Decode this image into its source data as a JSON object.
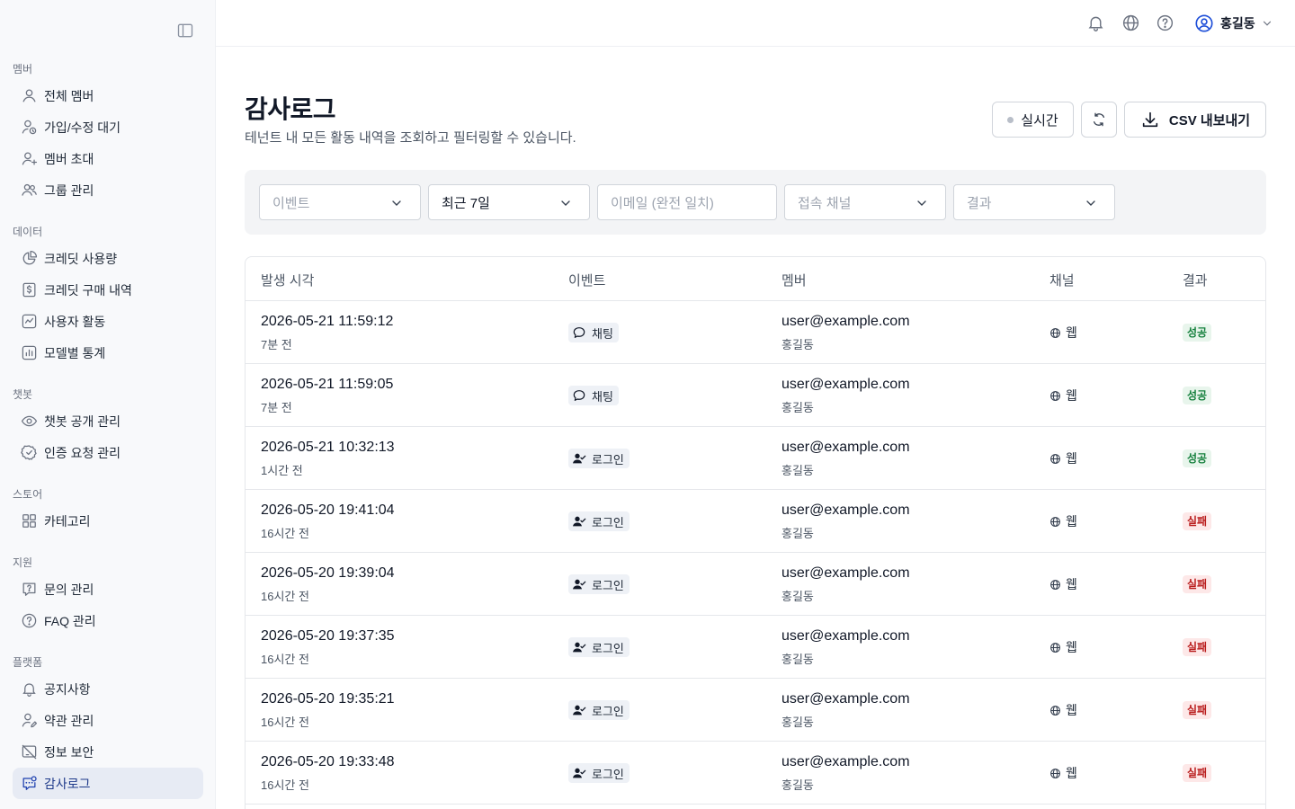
{
  "sidebar": {
    "groups": [
      {
        "title": "멤버",
        "items": [
          {
            "label": "전체 멤버",
            "icon": "user-icon"
          },
          {
            "label": "가입/수정 대기",
            "icon": "user-clock-icon"
          },
          {
            "label": "멤버 초대",
            "icon": "user-plus-icon"
          },
          {
            "label": "그룹 관리",
            "icon": "users-icon"
          }
        ]
      },
      {
        "title": "데이터",
        "items": [
          {
            "label": "크레딧 사용량",
            "icon": "pie-chart-icon"
          },
          {
            "label": "크레딧 구매 내역",
            "icon": "receipt-dollar-icon"
          },
          {
            "label": "사용자 활동",
            "icon": "activity-chart-icon"
          },
          {
            "label": "모델별 통계",
            "icon": "bar-chart-icon"
          }
        ]
      },
      {
        "title": "챗봇",
        "items": [
          {
            "label": "챗봇 공개 관리",
            "icon": "eye-icon"
          },
          {
            "label": "인증 요청 관리",
            "icon": "badge-check-icon"
          }
        ]
      },
      {
        "title": "스토어",
        "items": [
          {
            "label": "카테고리",
            "icon": "grid-icon"
          }
        ]
      },
      {
        "title": "지원",
        "items": [
          {
            "label": "문의 관리",
            "icon": "message-question-icon"
          },
          {
            "label": "FAQ 관리",
            "icon": "help-circle-icon"
          }
        ]
      },
      {
        "title": "플랫폼",
        "items": [
          {
            "label": "공지사항",
            "icon": "bell-icon"
          },
          {
            "label": "약관 관리",
            "icon": "user-pen-icon"
          },
          {
            "label": "정보 보안",
            "icon": "shield-off-icon"
          },
          {
            "label": "감사로그",
            "icon": "message-alert-icon",
            "active": true
          }
        ]
      }
    ]
  },
  "topbar": {
    "user_name": "홍길동",
    "icons": [
      "bell-icon",
      "globe-icon",
      "help-circle-icon"
    ]
  },
  "header": {
    "title": "감사로그",
    "subtitle": "테넌트 내 모든 활동 내역을 조회하고 필터링할 수 있습니다.",
    "live_label": "실시간",
    "csv_label": "CSV 내보내기"
  },
  "filters": {
    "event_placeholder": "이벤트",
    "range_value": "최근 7일",
    "email_placeholder": "이메일 (완전 일치)",
    "channel_placeholder": "접속 채널",
    "result_placeholder": "결과"
  },
  "table": {
    "columns": [
      "발생 시각",
      "이벤트",
      "멤버",
      "채널",
      "결과"
    ],
    "rows": [
      {
        "time": "2026-05-21 11:59:12",
        "ago": "7분 전",
        "event": "채팅",
        "event_icon": "chat-bubble-icon",
        "email": "user@example.com",
        "name": "홍길동",
        "channel": "웹",
        "result": "성공",
        "status": "success"
      },
      {
        "time": "2026-05-21 11:59:05",
        "ago": "7분 전",
        "event": "채팅",
        "event_icon": "chat-bubble-icon",
        "email": "user@example.com",
        "name": "홍길동",
        "channel": "웹",
        "result": "성공",
        "status": "success"
      },
      {
        "time": "2026-05-21 10:32:13",
        "ago": "1시간 전",
        "event": "로그인",
        "event_icon": "user-check-icon",
        "email": "user@example.com",
        "name": "홍길동",
        "channel": "웹",
        "result": "성공",
        "status": "success"
      },
      {
        "time": "2026-05-20 19:41:04",
        "ago": "16시간 전",
        "event": "로그인",
        "event_icon": "user-check-icon",
        "email": "user@example.com",
        "name": "홍길동",
        "channel": "웹",
        "result": "실패",
        "status": "fail"
      },
      {
        "time": "2026-05-20 19:39:04",
        "ago": "16시간 전",
        "event": "로그인",
        "event_icon": "user-check-icon",
        "email": "user@example.com",
        "name": "홍길동",
        "channel": "웹",
        "result": "실패",
        "status": "fail"
      },
      {
        "time": "2026-05-20 19:37:35",
        "ago": "16시간 전",
        "event": "로그인",
        "event_icon": "user-check-icon",
        "email": "user@example.com",
        "name": "홍길동",
        "channel": "웹",
        "result": "실패",
        "status": "fail"
      },
      {
        "time": "2026-05-20 19:35:21",
        "ago": "16시간 전",
        "event": "로그인",
        "event_icon": "user-check-icon",
        "email": "user@example.com",
        "name": "홍길동",
        "channel": "웹",
        "result": "실패",
        "status": "fail"
      },
      {
        "time": "2026-05-20 19:33:48",
        "ago": "16시간 전",
        "event": "로그인",
        "event_icon": "user-check-icon",
        "email": "user@example.com",
        "name": "홍길동",
        "channel": "웹",
        "result": "실패",
        "status": "fail"
      }
    ]
  }
}
